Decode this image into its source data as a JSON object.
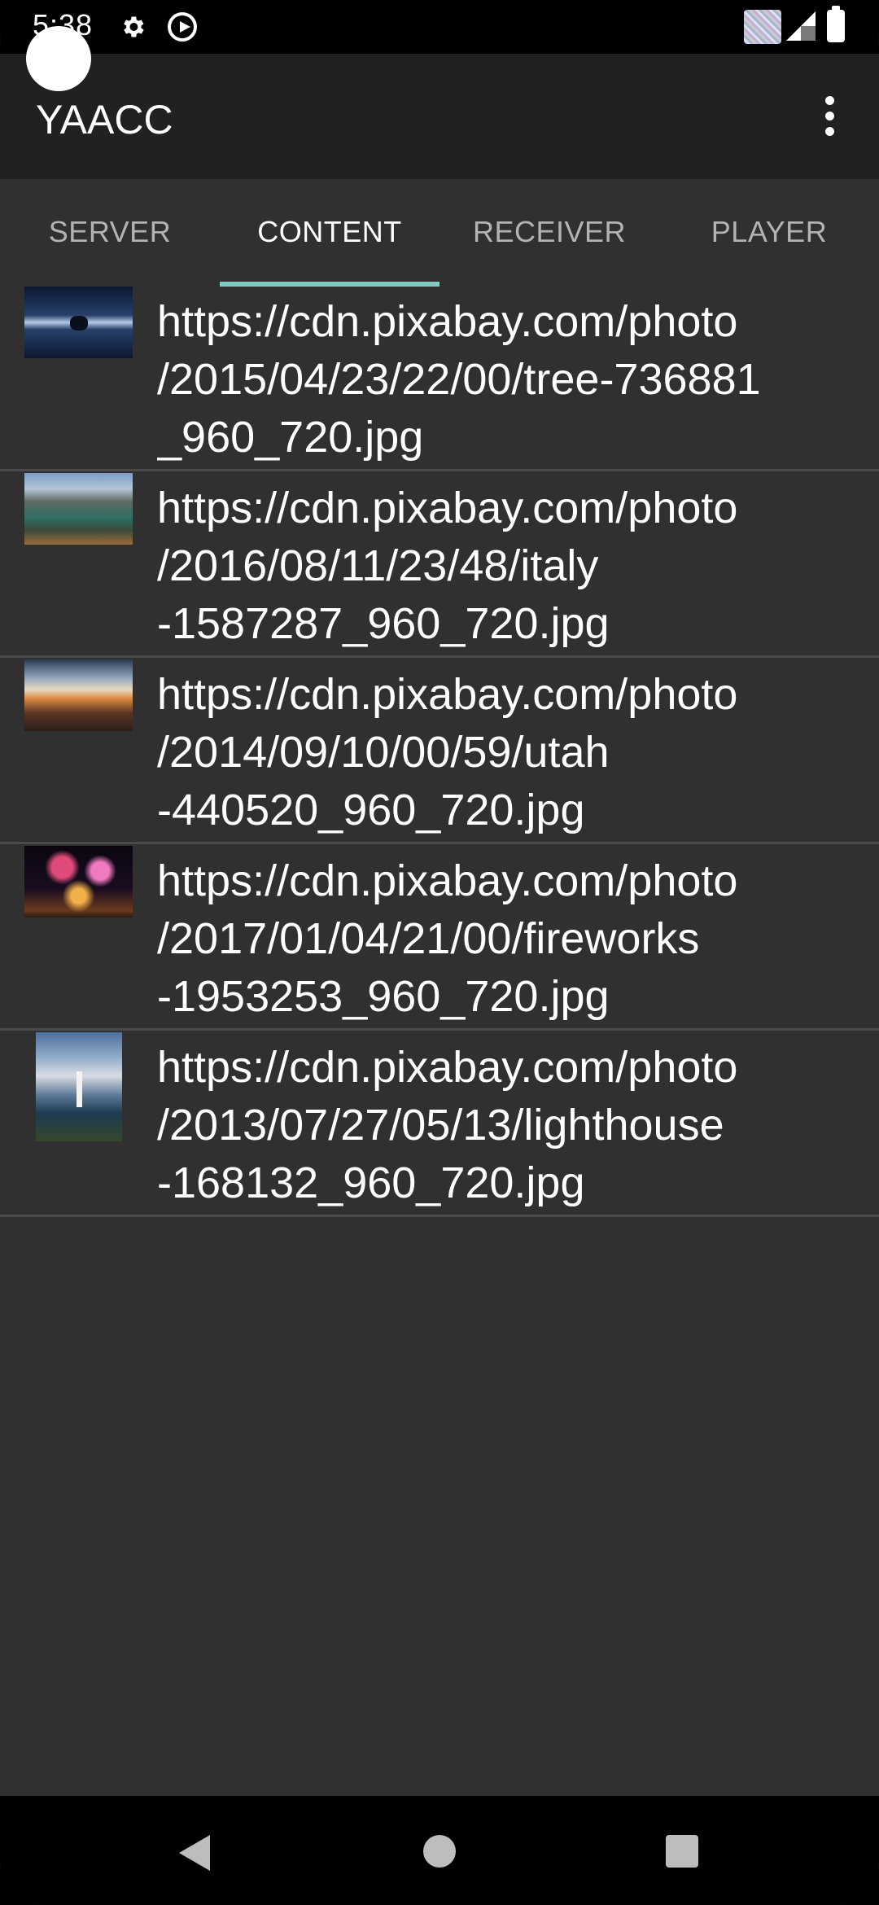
{
  "status_bar": {
    "time": "5:38",
    "icons": [
      "gear-icon",
      "play-circle-icon",
      "notification-thumbnail-icon",
      "signal-icon",
      "battery-icon"
    ]
  },
  "app_bar": {
    "title": "YAACC",
    "menu_icon": "overflow-menu-icon"
  },
  "tabs": [
    {
      "label": "SERVER",
      "active": false
    },
    {
      "label": "CONTENT",
      "active": true
    },
    {
      "label": "RECEIVER",
      "active": false
    },
    {
      "label": "PLAYER",
      "active": false
    }
  ],
  "items": [
    {
      "text": "https://cdn.pixabay.com/photo\n/2015/04/23/22/00/tree-736881\n_960_720.jpg",
      "thumbnail": "tree"
    },
    {
      "text": "https://cdn.pixabay.com/photo\n/2016/08/11/23/48/italy\n-1587287_960_720.jpg",
      "thumbnail": "italy"
    },
    {
      "text": "https://cdn.pixabay.com/photo\n/2014/09/10/00/59/utah\n-440520_960_720.jpg",
      "thumbnail": "utah"
    },
    {
      "text": "https://cdn.pixabay.com/photo\n/2017/01/04/21/00/fireworks\n-1953253_960_720.jpg",
      "thumbnail": "fireworks"
    },
    {
      "text": "https://cdn.pixabay.com/photo\n/2013/07/27/05/13/lighthouse\n-168132_960_720.jpg",
      "thumbnail": "lighthouse"
    }
  ],
  "nav_bar": {
    "icons": [
      "back-icon",
      "home-icon",
      "recents-icon"
    ]
  },
  "colors": {
    "background": "#303030",
    "app_bar": "#212121",
    "tab_indicator": "#80cbc4",
    "divider": "#4a4a4a"
  }
}
